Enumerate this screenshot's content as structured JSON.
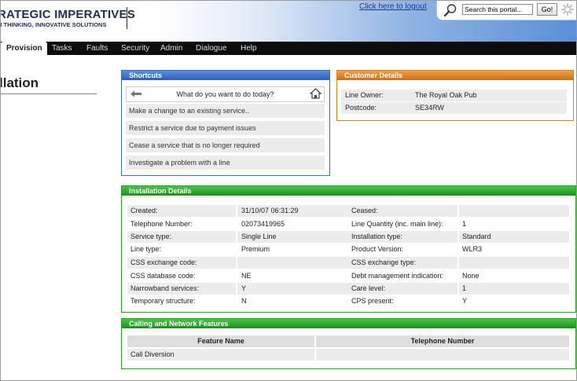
{
  "brand": {
    "title": "RATEGIC IMPERATIVES",
    "tagline": "H THINKING, INNOVATIVE SOLUTIONS"
  },
  "header": {
    "logout_label": "Click here to logout",
    "search_value": "Search this portal...",
    "go_label": "Go!"
  },
  "nav": {
    "items": [
      "Provision",
      "Tasks",
      "Faults",
      "Security",
      "Admin",
      "Dialogue",
      "Help"
    ],
    "active": "Provision"
  },
  "page": {
    "title": "llation"
  },
  "shortcuts": {
    "header": "Shortcuts",
    "title": "What do you want to do today?",
    "items": [
      "Make a change to an existing service..",
      "Restrict a service due to payment issues",
      "Cease a service that is no longer required",
      "Investigate a problem with a line"
    ]
  },
  "customer": {
    "header": "Customer Details",
    "rows": [
      {
        "label": "Line Owner:",
        "value": "The Royal Oak Pub"
      },
      {
        "label": "Postcode:",
        "value": "SE34RW"
      }
    ]
  },
  "installation": {
    "header": "Installation Details",
    "rows": [
      {
        "l1": "Created:",
        "v1": "31/10/07 06:31:29",
        "l2": "Ceased:",
        "v2": ""
      },
      {
        "l1": "Telephone Number:",
        "v1": "02073419965",
        "l2": "Line Quantity (inc. main line):",
        "v2": "1"
      },
      {
        "l1": "Service type:",
        "v1": "Single Line",
        "l2": "Installation type:",
        "v2": "Standard"
      },
      {
        "l1": "Line type:",
        "v1": "Premium",
        "l2": "Product Version:",
        "v2": "WLR3"
      },
      {
        "l1": "CSS exchange code:",
        "v1": "",
        "l2": "CSS exchange type:",
        "v2": ""
      },
      {
        "l1": "CSS database code:",
        "v1": "NE",
        "l2": "Debt management indication:",
        "v2": "None"
      },
      {
        "l1": "Narrowband services:",
        "v1": "Y",
        "l2": "Care level:",
        "v2": "1"
      },
      {
        "l1": "Temporary structure:",
        "v1": "N",
        "l2": "CPS present:",
        "v2": "Y"
      }
    ]
  },
  "features": {
    "header": "Calling and Network Features",
    "columns": [
      "Feature Name",
      "Telephone Number"
    ],
    "rows": [
      {
        "name": "Call Diversion",
        "number": ""
      }
    ]
  },
  "colors": {
    "shortcuts_accent": "#2c5fb5",
    "customer_accent": "#c97018",
    "installation_accent": "#1e8f1e",
    "nav_background": "#0c0c0c"
  },
  "icons": [
    "search-icon",
    "settings-gear-icon",
    "back-arrow-icon",
    "home-icon"
  ]
}
